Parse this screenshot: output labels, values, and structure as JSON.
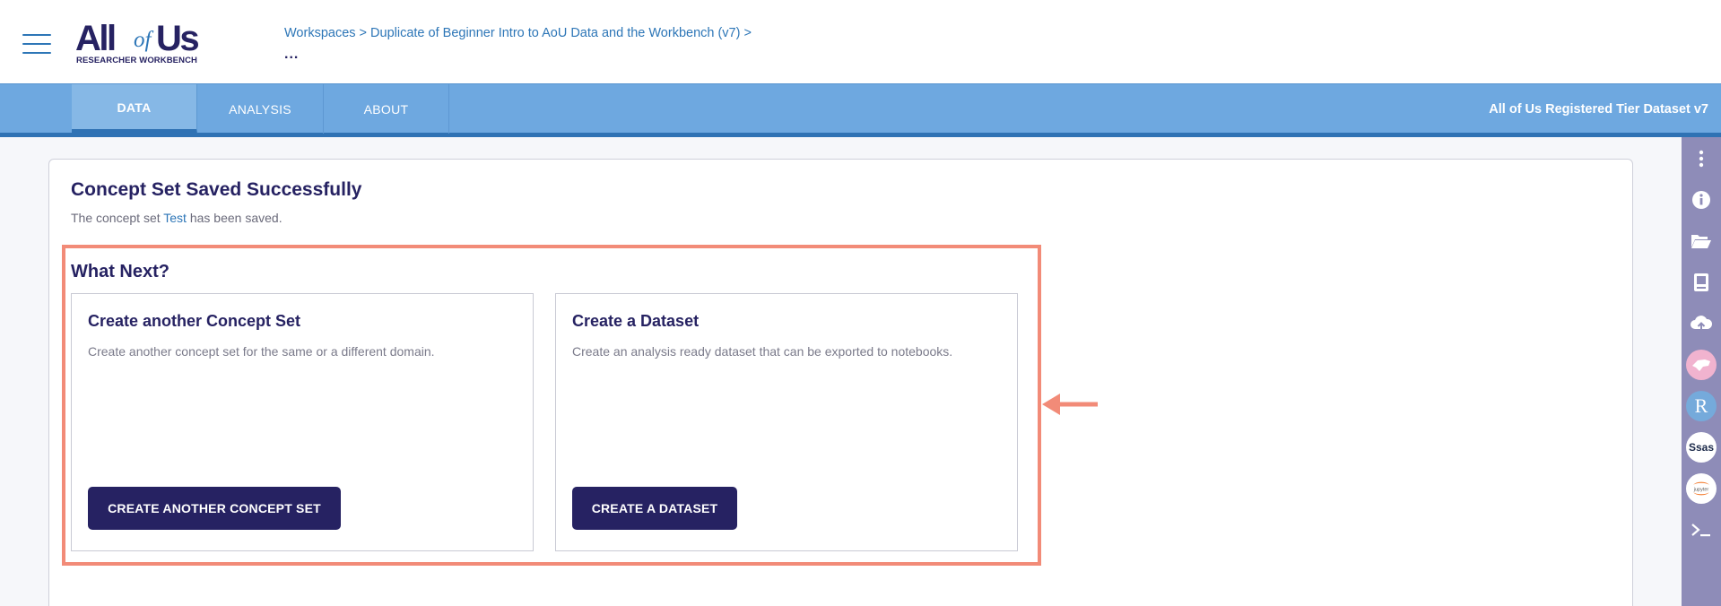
{
  "header": {
    "logo": {
      "all": "All",
      "of": "of",
      "us": "Us",
      "subtitle": "RESEARCHER WORKBENCH"
    },
    "breadcrumb": {
      "workspaces": "Workspaces",
      "separator": ">",
      "workspace_name": "Duplicate of Beginner Intro to AoU Data and the Workbench (v7)",
      "trailing_separator": ">",
      "ellipsis": "..."
    }
  },
  "nav": {
    "tabs": [
      {
        "label": "DATA",
        "active": true
      },
      {
        "label": "ANALYSIS",
        "active": false
      },
      {
        "label": "ABOUT",
        "active": false
      }
    ],
    "dataset_version": "All of Us Registered Tier Dataset v7"
  },
  "rail": {
    "icons": [
      "more-vertical-icon",
      "info-icon",
      "folder-open-icon",
      "notebook-icon",
      "cloud-upload-icon",
      "cromwell-icon",
      "rstudio-icon",
      "sas-icon",
      "jupyter-icon",
      "terminal-icon"
    ]
  },
  "main": {
    "title": "Concept Set Saved Successfully",
    "subtitle_prefix": "The concept set",
    "concept_set_name": "Test",
    "subtitle_suffix": "has been saved.",
    "what_next": "What Next?",
    "options": [
      {
        "title": "Create another Concept Set",
        "description": "Create another concept set for the same or a different domain.",
        "button": "CREATE ANOTHER CONCEPT SET"
      },
      {
        "title": "Create a Dataset",
        "description": "Create an analysis ready dataset that can be exported to notebooks.",
        "button": "CREATE A DATASET"
      }
    ]
  },
  "colors": {
    "navy": "#262262",
    "link_blue": "#2d76b7",
    "nav_blue": "#6ea8e0",
    "rail_purple": "#8e8cb8",
    "highlight_salmon": "#f28b78"
  }
}
